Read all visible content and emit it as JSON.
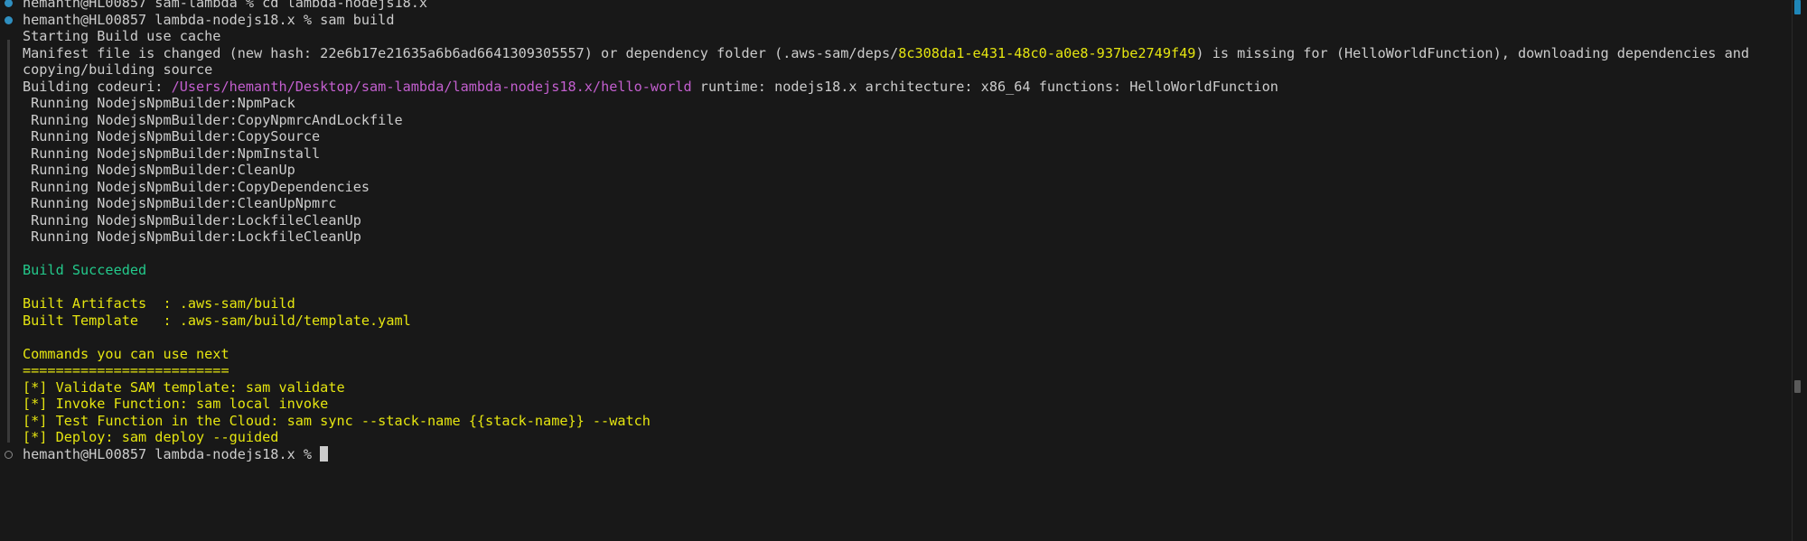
{
  "colors": {
    "background": "#181818",
    "text": "#cccccc",
    "path": "#c35fcf",
    "highlight": "#e5e510",
    "success": "#23c98b",
    "prompt_dot_success": "#2f8fc0"
  },
  "prev_command": "hemanth@HL00857 sam-lambda % cd lambda-nodejs18.x",
  "command": "hemanth@HL00857 lambda-nodejs18.x % sam build",
  "output": {
    "starting": "Starting Build use cache",
    "manifest_a": "Manifest file is changed (new hash: 22e6b17e21635a6b6ad6641309305557) or dependency folder (.aws-sam/deps/",
    "manifest_hash": "8c308da1-e431-48c0-a0e8-937be2749f49",
    "manifest_b": ") is missing for (HelloWorldFunction), downloading dependencies and",
    "copying": "copying/building source",
    "building_a": "Building codeuri: ",
    "building_path": "/Users/hemanth/Desktop/sam-lambda/lambda-nodejs18.x/hello-world",
    "building_b": " runtime: nodejs18.x architecture: x86_64 functions: HelloWorldFunction",
    "steps": [
      " Running NodejsNpmBuilder:NpmPack",
      " Running NodejsNpmBuilder:CopyNpmrcAndLockfile",
      " Running NodejsNpmBuilder:CopySource",
      " Running NodejsNpmBuilder:NpmInstall",
      " Running NodejsNpmBuilder:CleanUp",
      " Running NodejsNpmBuilder:CopyDependencies",
      " Running NodejsNpmBuilder:CleanUpNpmrc",
      " Running NodejsNpmBuilder:LockfileCleanUp",
      " Running NodejsNpmBuilder:LockfileCleanUp"
    ],
    "succeeded": "Build Succeeded",
    "artifacts": "Built Artifacts  : .aws-sam/build",
    "template": "Built Template   : .aws-sam/build/template.yaml",
    "next_title": "Commands you can use next",
    "separator": "=========================",
    "next": [
      "[*] Validate SAM template: sam validate",
      "[*] Invoke Function: sam local invoke",
      "[*] Test Function in the Cloud: sam sync --stack-name {{stack-name}} --watch",
      "[*] Deploy: sam deploy --guided"
    ]
  },
  "prompt": "hemanth@HL00857 lambda-nodejs18.x % "
}
